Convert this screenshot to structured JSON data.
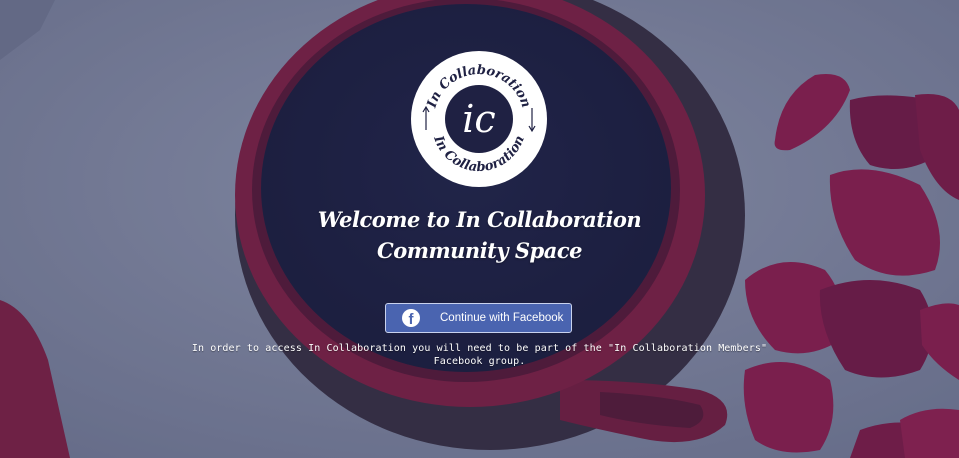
{
  "logo": {
    "ring_text_top": "In Collaboration",
    "ring_text_bottom": "In Collaboration",
    "monogram": "ic"
  },
  "welcome": {
    "line1": "Welcome to In Collaboration",
    "line2": "Community Space"
  },
  "login": {
    "button_label": "Continue with Facebook",
    "button_icon": "facebook-icon",
    "button_color": "#4a64b0"
  },
  "notice": {
    "text": "In order to access In Collaboration you will need to be part of the \"In Collaboration Members\" Facebook group."
  },
  "colors": {
    "mug_red": "#8e1e42",
    "petal_red": "#9a1a48",
    "background_grey": "#9aa0b4"
  }
}
